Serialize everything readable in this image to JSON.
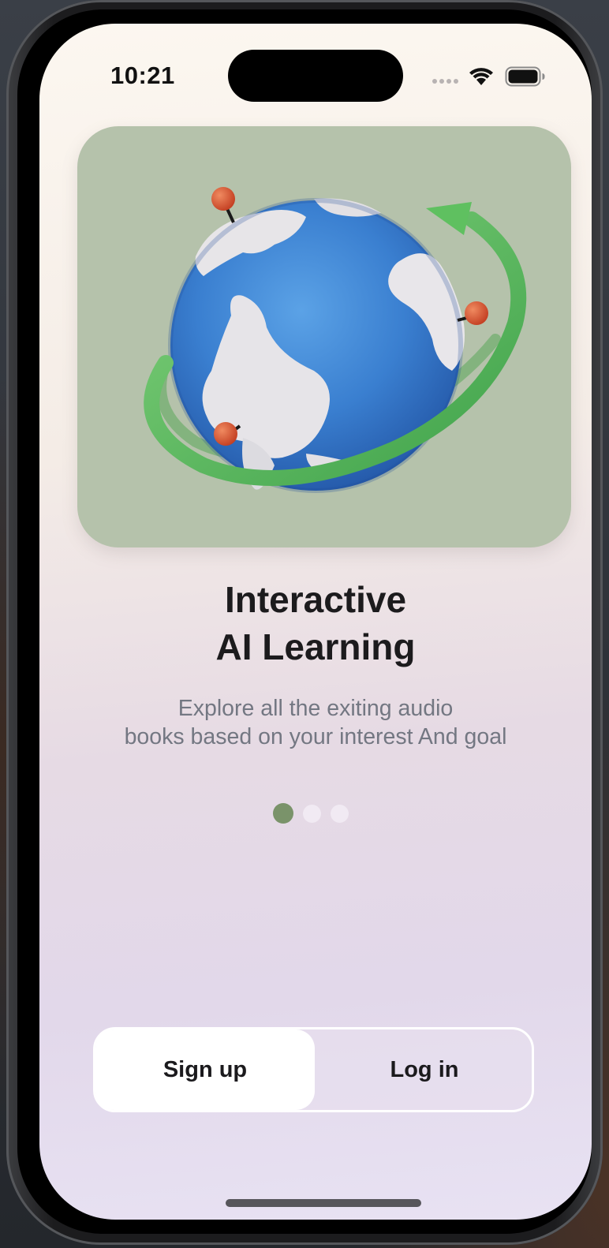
{
  "status_bar": {
    "time": "10:21"
  },
  "onboarding": {
    "title_line1": "Interactive",
    "title_line2": "AI Learning",
    "subtitle_line1": "Explore all the exiting audio",
    "subtitle_line2": "books based on your interest And goal",
    "page_count": 3,
    "active_page": 1
  },
  "auth": {
    "signup_label": "Sign up",
    "login_label": "Log in",
    "selected": "Sign up"
  },
  "colors": {
    "card_bg": "#b5c2ab",
    "active_dot": "#7a936a",
    "inactive_dot": "#f1eaf3",
    "title_text": "#1c1b1d",
    "subtitle_text": "#737782"
  },
  "icons": [
    "wifi-icon",
    "battery-icon",
    "cellular-signal-icon",
    "globe-illustration"
  ]
}
